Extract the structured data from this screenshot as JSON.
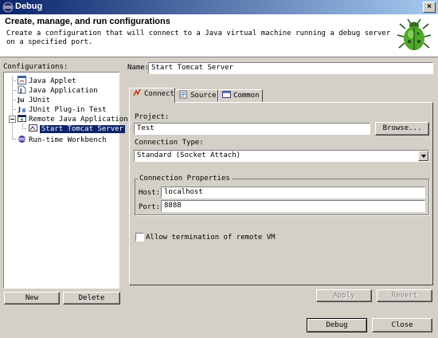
{
  "window": {
    "title": "Debug",
    "close_glyph": "×"
  },
  "header": {
    "title": "Create, manage, and run configurations",
    "description": "Create a configuration that will connect to a Java virtual machine running a debug server on a specified port.",
    "icon": "bug-icon"
  },
  "configurations": {
    "label": "Configurations:",
    "items": [
      {
        "label": "Java Applet",
        "icon": "java-applet-icon"
      },
      {
        "label": "Java Application",
        "icon": "java-application-icon"
      },
      {
        "label": "JUnit",
        "icon": "junit-icon"
      },
      {
        "label": "JUnit Plug-in Test",
        "icon": "junit-plugin-icon"
      },
      {
        "label": "Remote Java Application",
        "icon": "remote-java-icon",
        "expanded": true
      },
      {
        "label": "Start Tomcat Server",
        "icon": "remote-config-icon",
        "selected": true
      },
      {
        "label": "Run-time Workbench",
        "icon": "workbench-icon"
      }
    ],
    "new_button": "New",
    "delete_button": "Delete"
  },
  "name": {
    "label": "Name:",
    "value": "Start Tomcat Server"
  },
  "tabs": [
    {
      "label": "Connect",
      "active": true
    },
    {
      "label": "Source",
      "active": false
    },
    {
      "label": "Common",
      "active": false
    }
  ],
  "connect": {
    "project_label": "Project:",
    "project_value": "Test",
    "browse_button": "Browse...",
    "connection_type_label": "Connection Type:",
    "connection_type_value": "Standard (Socket Attach)",
    "properties_group_label": "Connection Properties",
    "host_label": "Host:",
    "host_value": "localhost",
    "port_label": "Port:",
    "port_value": "8888",
    "allow_termination_label": "Allow termination of remote VM",
    "allow_termination_checked": false
  },
  "actions": {
    "apply": "Apply",
    "revert": "Revert",
    "debug": "Debug",
    "close": "Close"
  },
  "colors": {
    "titlebar_start": "#0a246a",
    "titlebar_end": "#a6caf0",
    "selection": "#0a246a",
    "dialog_bg": "#d4d0c8"
  }
}
